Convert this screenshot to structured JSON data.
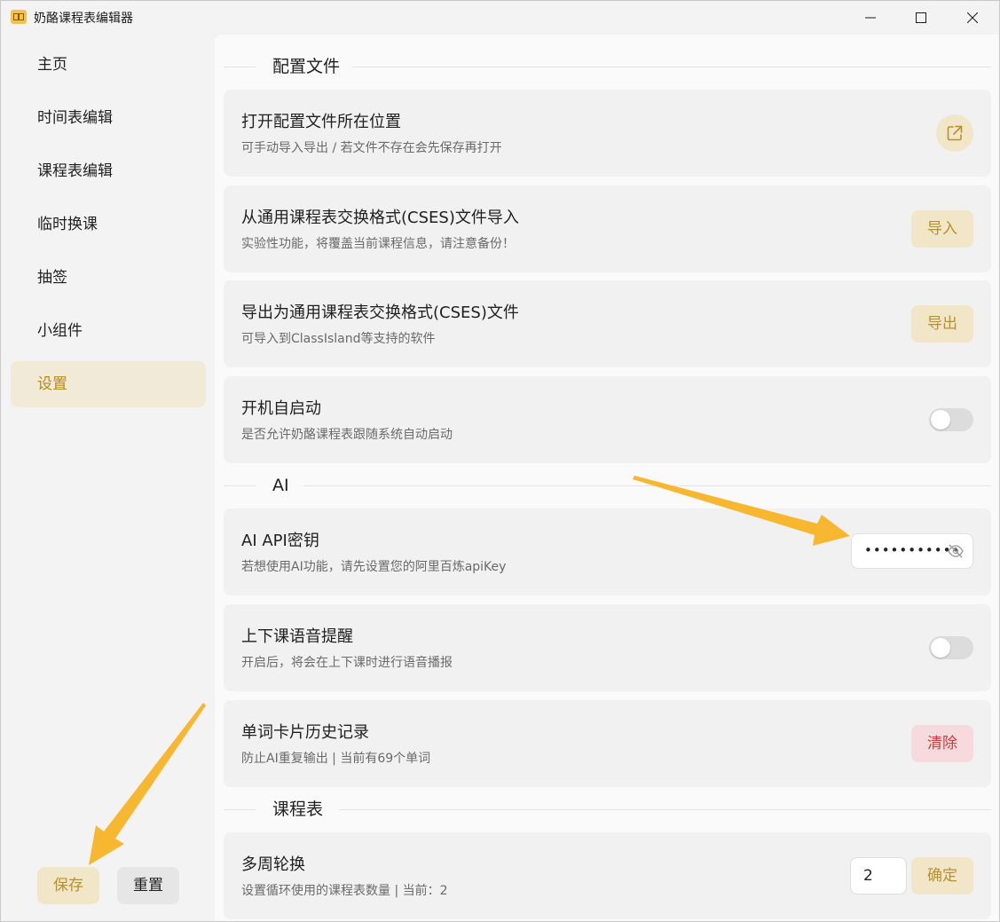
{
  "window": {
    "title": "奶酪课程表编辑器",
    "controls": [
      "minimize",
      "maximize",
      "close"
    ]
  },
  "sidebar": {
    "items": [
      {
        "label": "主页",
        "active": false
      },
      {
        "label": "时间表编辑",
        "active": false
      },
      {
        "label": "课程表编辑",
        "active": false
      },
      {
        "label": "临时换课",
        "active": false
      },
      {
        "label": "抽签",
        "active": false
      },
      {
        "label": "小组件",
        "active": false
      },
      {
        "label": "设置",
        "active": true
      }
    ],
    "save_label": "保存",
    "reset_label": "重置"
  },
  "sections": {
    "config": "配置文件",
    "ai": "AI",
    "schedule": "课程表"
  },
  "cards": {
    "open_config": {
      "title": "打开配置文件所在位置",
      "desc": "可手动导入导出 / 若文件不存在会先保存再打开",
      "icon": "open-external-icon"
    },
    "import_cses": {
      "title": "从通用课程表交换格式(CSES)文件导入",
      "desc": "实验性功能，将覆盖当前课程信息，请注意备份！",
      "button": "导入"
    },
    "export_cses": {
      "title": "导出为通用课程表交换格式(CSES)文件",
      "desc": "可导入到ClassIsland等支持的软件",
      "button": "导出"
    },
    "autostart": {
      "title": "开机自启动",
      "desc": "是否允许奶酪课程表跟随系统自动启动",
      "enabled": false
    },
    "ai_key": {
      "title": "AI API密钥",
      "desc": "若想使用AI功能，请先设置您的阿里百炼apiKey",
      "masked_value": "•••••••••••"
    },
    "voice": {
      "title": "上下课语音提醒",
      "desc": "开启后，将会在上下课时进行语音播报",
      "enabled": false
    },
    "word_history": {
      "title": "单词卡片历史记录",
      "desc": "防止AI重复输出 | 当前有69个单词",
      "button": "清除"
    },
    "multi_week": {
      "title": "多周轮换",
      "desc": "设置循环使用的课程表数量 | 当前：2",
      "value": "2",
      "button": "确定"
    }
  },
  "colors": {
    "accent": "#b8902c",
    "accent_bg": "#f1e6c7",
    "danger": "#c8403f",
    "danger_bg": "#f6dadd",
    "annotation_arrow": "#f7b731"
  }
}
